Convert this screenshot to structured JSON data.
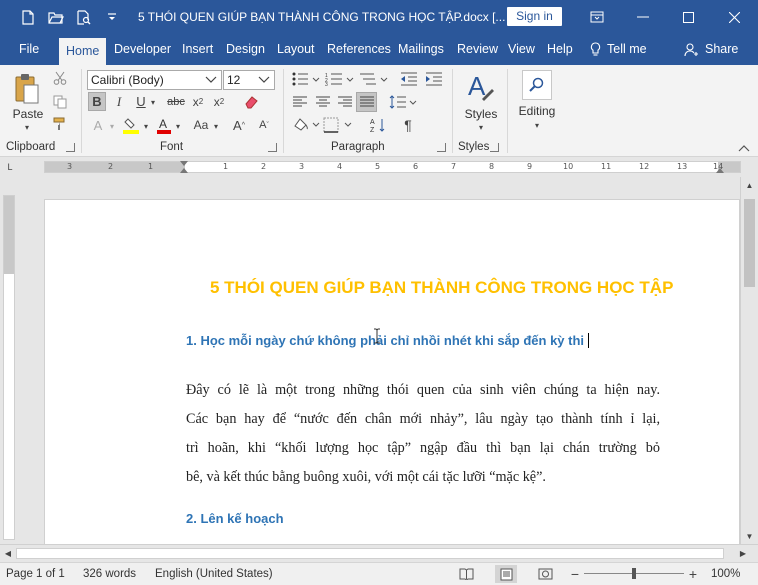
{
  "window": {
    "title": "5 THÓI QUEN GIÚP BẠN THÀNH CÔNG TRONG HỌC TẬP.docx [...",
    "signin": "Sign in"
  },
  "tabs": [
    {
      "label": "File"
    },
    {
      "label": "Home"
    },
    {
      "label": "Developer"
    },
    {
      "label": "Insert"
    },
    {
      "label": "Design"
    },
    {
      "label": "Layout"
    },
    {
      "label": "References"
    },
    {
      "label": "Mailings"
    },
    {
      "label": "Review"
    },
    {
      "label": "View"
    },
    {
      "label": "Help"
    }
  ],
  "tell_me": "Tell me",
  "share": "Share",
  "ribbon": {
    "paste": "Paste",
    "font_name": "Calibri (Body)",
    "font_size": "12",
    "styles": "Styles",
    "editing": "Editing",
    "groups": {
      "clipboard": "Clipboard",
      "font": "Font",
      "paragraph": "Paragraph",
      "styles": "Styles"
    }
  },
  "document": {
    "title": "5 THÓI QUEN GIÚP BẠN THÀNH CÔNG TRONG HỌC TẬP",
    "heading1": "1. Học mỗi ngày chứ không phải chỉ nhồi nhét khi sắp đến kỳ thi",
    "paragraph": [
      "Đây có lẽ là một trong những thói quen của sinh viên chúng ta hiện nay.",
      "Các bạn hay để “nước đến chân mới nhảy”, lâu ngày tạo thành tính ỉ lại,",
      "trì hoãn, khi “khối lượng học tập” ngập đầu thì bạn lại chán trường bỏ",
      "bê, và kết thúc bằng buông xuôi, với một cái tặc lưỡi “mặc kệ”."
    ],
    "heading2": "2. Lên kế hoạch"
  },
  "ruler_numbers": [
    "3",
    "2",
    "1",
    "1",
    "2",
    "3",
    "4",
    "5",
    "6",
    "7",
    "8",
    "9",
    "10",
    "11",
    "12",
    "13",
    "14"
  ],
  "status": {
    "page": "Page 1 of 1",
    "words": "326 words",
    "language": "English (United States)",
    "zoom": "100%"
  },
  "colors": {
    "accent": "#2b579a",
    "doc_title": "#ffc000",
    "heading": "#2e74b5"
  }
}
